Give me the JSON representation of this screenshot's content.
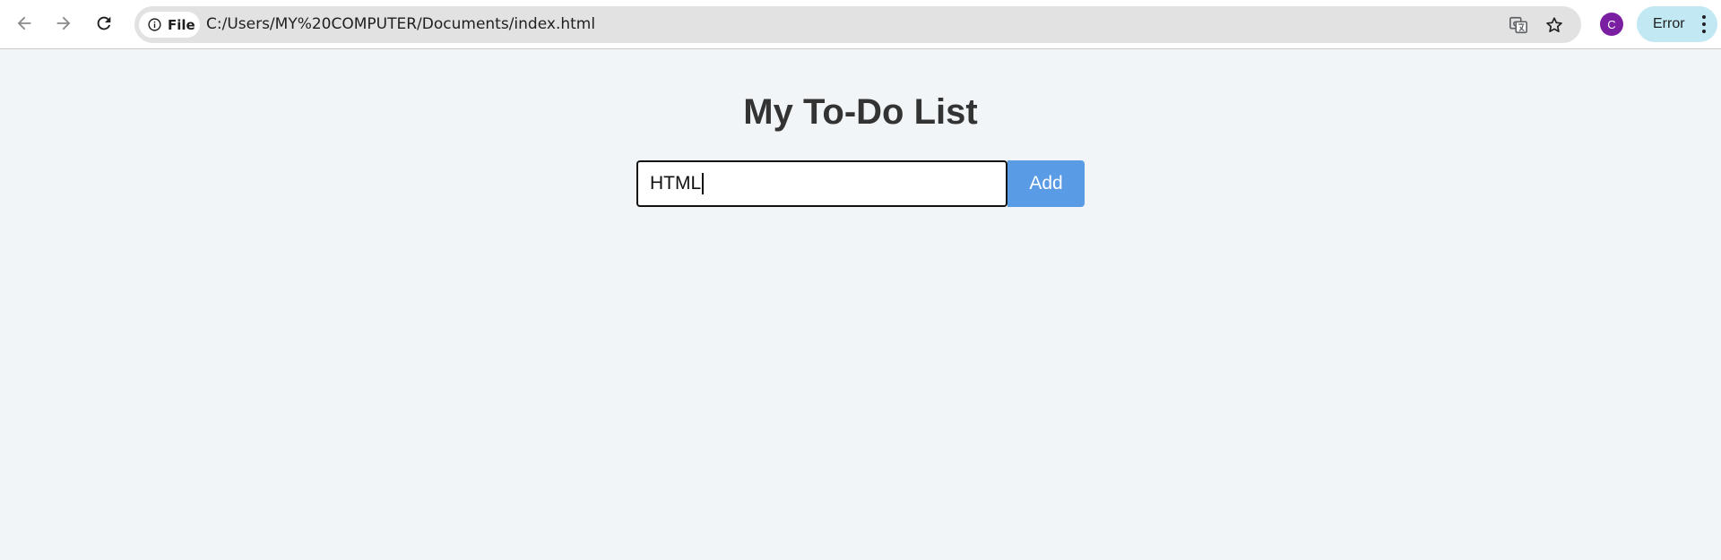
{
  "browser": {
    "site_info_label": "File",
    "url": "C:/Users/MY%20COMPUTER/Documents/index.html",
    "profile_initial": "C",
    "profile_color": "#7b1fa2",
    "error_label": "Error",
    "icons": [
      "back-arrow-icon",
      "forward-arrow-icon",
      "reload-icon",
      "info-icon",
      "translate-icon",
      "star-icon",
      "kebab-menu-icon"
    ]
  },
  "page": {
    "title": "My To-Do List",
    "input_value": "HTML",
    "add_button_label": "Add",
    "accent_color": "#5a9be6",
    "background_color": "#f1f5f7"
  }
}
